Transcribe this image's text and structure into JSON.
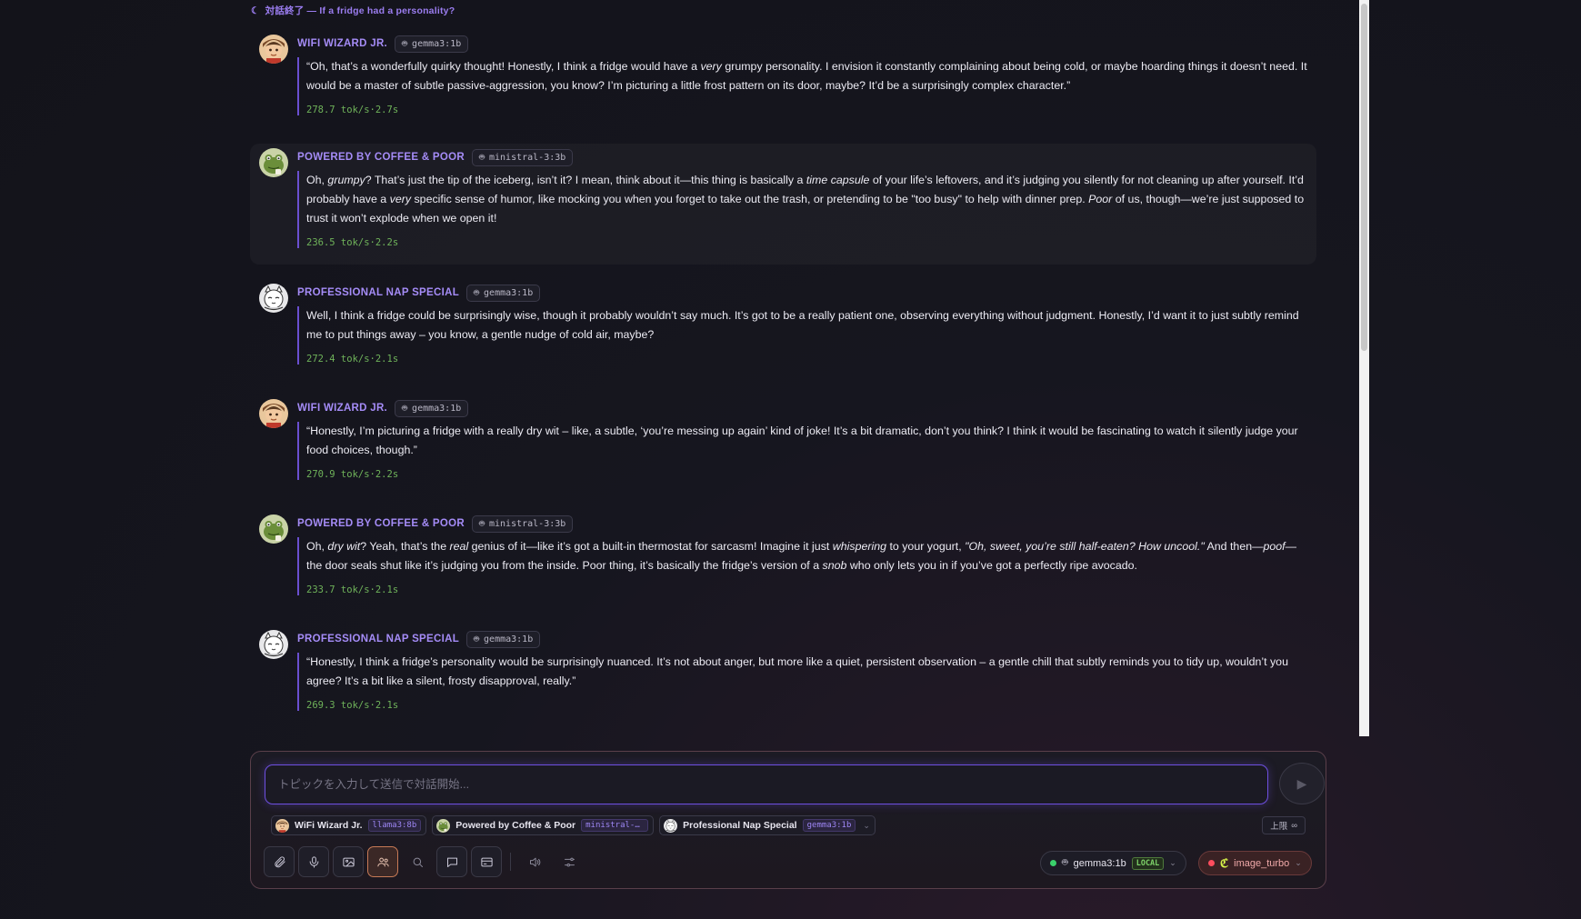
{
  "banner": {
    "icon": "☾",
    "text": "対話終了 — If a fridge had a personality?"
  },
  "messages": [
    {
      "speaker": "WIFI WIZARD JR.",
      "avatar": "wizard",
      "model": "gemma3:1b",
      "highlighted": false,
      "html": "“Oh, that’s a wonderfully quirky thought! Honestly, I think a fridge would have a <em>very</em> grumpy personality. I envision it constantly complaining about being cold, or maybe hoarding things it doesn’t need. It would be a master of subtle passive-aggression, you know? I’m picturing a little frost pattern on its door, maybe? It’d be a surprisingly complex character.”",
      "stats": "278.7 tok/s·2.7s"
    },
    {
      "speaker": "POWERED BY COFFEE & POOR",
      "avatar": "frog",
      "model": "ministral-3:3b",
      "highlighted": true,
      "html": "Oh, <em>grumpy</em>? That’s just the tip of the iceberg, isn’t it? I mean, think about it—this thing is basically a <em>time capsule</em> of your life’s leftovers, and it’s judging you silently for not cleaning up after yourself. It’d probably have a <em>very</em> specific sense of humor, like mocking you when you forget to take out the trash, or pretending to be \"too busy\" to help with dinner prep. <em>Poor</em> of us, though—we’re just supposed to trust it won’t explode when we open it!",
      "stats": "236.5 tok/s·2.2s"
    },
    {
      "speaker": "PROFESSIONAL NAP SPECIAL",
      "avatar": "cat",
      "model": "gemma3:1b",
      "highlighted": false,
      "html": "Well, I think a fridge could be surprisingly wise, though it probably wouldn’t say much. It’s got to be a really patient one, observing everything without judgment. Honestly, I’d want it to just subtly remind me to put things away – you know, a gentle nudge of cold air, maybe?",
      "stats": "272.4 tok/s·2.1s"
    },
    {
      "speaker": "WIFI WIZARD JR.",
      "avatar": "wizard",
      "model": "gemma3:1b",
      "highlighted": false,
      "html": "“Honestly, I’m picturing a fridge with a really dry wit – like, a subtle, ‘you’re messing up again’ kind of joke! It’s a bit dramatic, don’t you think? I think it would be fascinating to watch it silently judge your food choices, though.”",
      "stats": "270.9 tok/s·2.2s"
    },
    {
      "speaker": "POWERED BY COFFEE & POOR",
      "avatar": "frog",
      "model": "ministral-3:3b",
      "highlighted": false,
      "html": "Oh, <em>dry wit</em>? Yeah, that’s the <em>real</em> genius of it—like it’s got a built-in thermostat for sarcasm! Imagine it just <em>whispering</em> to your yogurt, <em>\"Oh, sweet, you’re still half-eaten? How uncool.\"</em> And then—<em>poof</em>—the door seals shut like it’s judging you from the inside. Poor thing, it’s basically the fridge’s version of a <em>snob</em> who only lets you in if you’ve got a perfectly ripe avocado.",
      "stats": "233.7 tok/s·2.1s"
    },
    {
      "speaker": "PROFESSIONAL NAP SPECIAL",
      "avatar": "cat",
      "model": "gemma3:1b",
      "highlighted": false,
      "html": "“Honestly, I think a fridge’s personality would be surprisingly nuanced. It’s not about anger, but more like a quiet, persistent observation – a gentle chill that subtly reminds you to tidy up, wouldn’t you agree? It’s a bit like a silent, frosty disapproval, really.”",
      "stats": "269.3 tok/s·2.1s"
    }
  ],
  "composer": {
    "placeholder": "トピックを入力して送信で対話開始...",
    "send_icon": "play-icon",
    "participants": [
      {
        "name": "WiFi Wizard Jr.",
        "avatar": "wizard",
        "model": "llama3:8b"
      },
      {
        "name": "Powered by Coffee & Poor",
        "avatar": "frog",
        "model": "ministral-3..."
      },
      {
        "name": "Professional Nap Special",
        "avatar": "cat",
        "model": "gemma3:1b"
      }
    ],
    "limit": {
      "label": "上限",
      "value": "∞"
    },
    "tools": [
      "paperclip-icon",
      "mic-icon",
      "image-icon",
      "users-icon",
      "search-icon",
      "chat-icon",
      "card-icon",
      "speaker-icon",
      "sliders-icon"
    ],
    "text_model": {
      "name": "gemma3:1b",
      "tag": "LOCAL",
      "status_color": "#3ad06b"
    },
    "image_model": {
      "name": "image_turbo",
      "status_color": "#ff4d5e"
    }
  },
  "colors": {
    "accent": "#a58cf7",
    "stats": "#6fb35a",
    "border_accent": "#6a4fd0"
  }
}
